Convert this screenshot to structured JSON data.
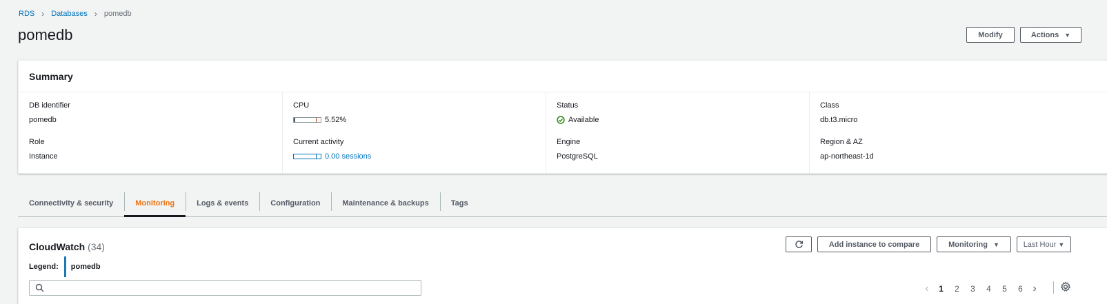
{
  "breadcrumb": {
    "items": [
      "RDS",
      "Databases"
    ],
    "current": "pomedb"
  },
  "page": {
    "title": "pomedb",
    "modify_label": "Modify",
    "actions_label": "Actions"
  },
  "summary": {
    "title": "Summary",
    "db_identifier": {
      "label": "DB identifier",
      "value": "pomedb"
    },
    "role": {
      "label": "Role",
      "value": "Instance"
    },
    "cpu": {
      "label": "CPU",
      "value": "5.52%",
      "fraction": 0.0552
    },
    "activity": {
      "label": "Current activity",
      "value": "0.00 sessions",
      "fraction": 0.0
    },
    "status": {
      "label": "Status",
      "value": "Available"
    },
    "engine": {
      "label": "Engine",
      "value": "PostgreSQL"
    },
    "class": {
      "label": "Class",
      "value": "db.t3.micro"
    },
    "region": {
      "label": "Region & AZ",
      "value": "ap-northeast-1d"
    }
  },
  "tabs": [
    {
      "label": "Connectivity & security"
    },
    {
      "label": "Monitoring",
      "active": true
    },
    {
      "label": "Logs & events"
    },
    {
      "label": "Configuration"
    },
    {
      "label": "Maintenance & backups"
    },
    {
      "label": "Tags"
    }
  ],
  "cloudwatch": {
    "title": "CloudWatch",
    "count": "(34)",
    "legend_label": "Legend:",
    "legend_item": "pomedb",
    "search_placeholder": "",
    "add_instance_label": "Add instance to compare",
    "monitoring_label": "Monitoring",
    "range_label": "Last Hour",
    "pages": [
      "1",
      "2",
      "3",
      "4",
      "5",
      "6"
    ],
    "current_page": "1"
  },
  "colors": {
    "link": "#0073bb",
    "active_tab": "#ec7211",
    "status_ok": "#1d8102",
    "legend": "#1f77b4"
  }
}
